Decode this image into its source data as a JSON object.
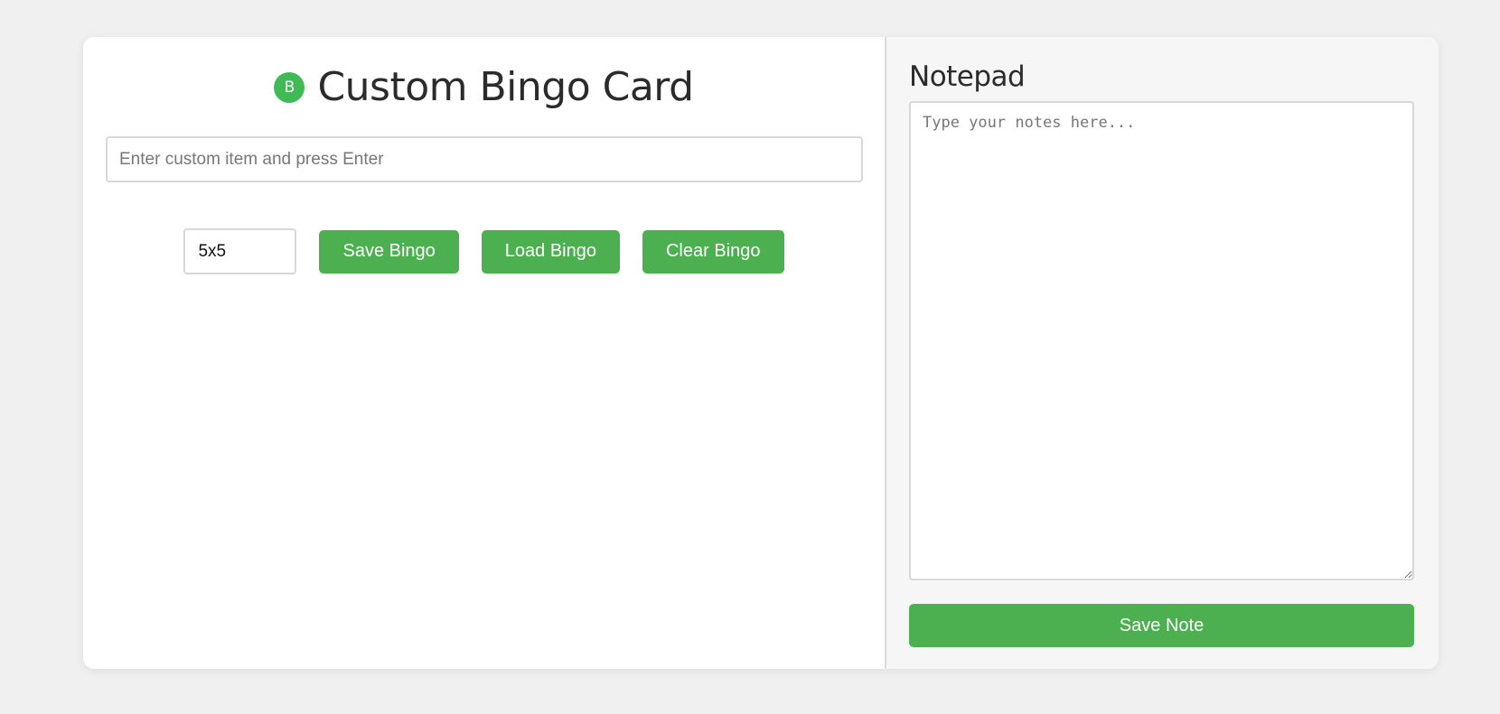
{
  "app": {
    "logo_letter": "B",
    "title": "Custom Bingo Card"
  },
  "custom_item": {
    "placeholder": "Enter custom item and press Enter",
    "value": ""
  },
  "controls": {
    "size_value": "5x5",
    "save_label": "Save Bingo",
    "load_label": "Load Bingo",
    "clear_label": "Clear Bingo"
  },
  "notepad": {
    "title": "Notepad",
    "placeholder": "Type your notes here...",
    "value": "",
    "save_label": "Save Note"
  },
  "colors": {
    "accent": "#4caf50",
    "logo_bg": "#3fba55",
    "page_bg": "#f0f0f0",
    "notepad_bg": "#f6f6f6"
  }
}
